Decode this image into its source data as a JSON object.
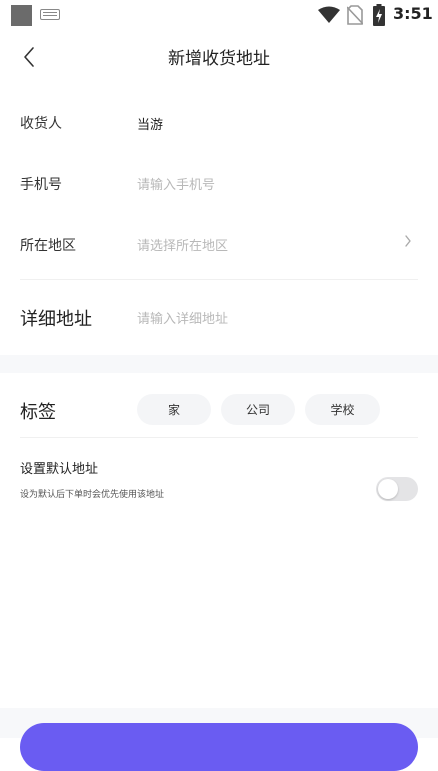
{
  "status_bar": {
    "time": "3:51"
  },
  "header": {
    "title": "新增收货地址"
  },
  "form": {
    "recipient_label": "收货人",
    "recipient_value": "当游",
    "phone_label": "手机号",
    "phone_placeholder": "请输入手机号",
    "region_label": "所在地区",
    "region_placeholder": "请选择所在地区",
    "address_label": "详细地址",
    "address_placeholder": "请输入详细地址"
  },
  "tags": {
    "label": "标签",
    "items": [
      "家",
      "公司",
      "学校"
    ]
  },
  "default_address": {
    "title": "设置默认地址",
    "subtitle": "设为默认后下单时会优先使用该地址",
    "enabled": false
  },
  "colors": {
    "accent": "#6a5cf2",
    "placeholder": "#b8b8b8",
    "band": "#f7f8fa"
  }
}
